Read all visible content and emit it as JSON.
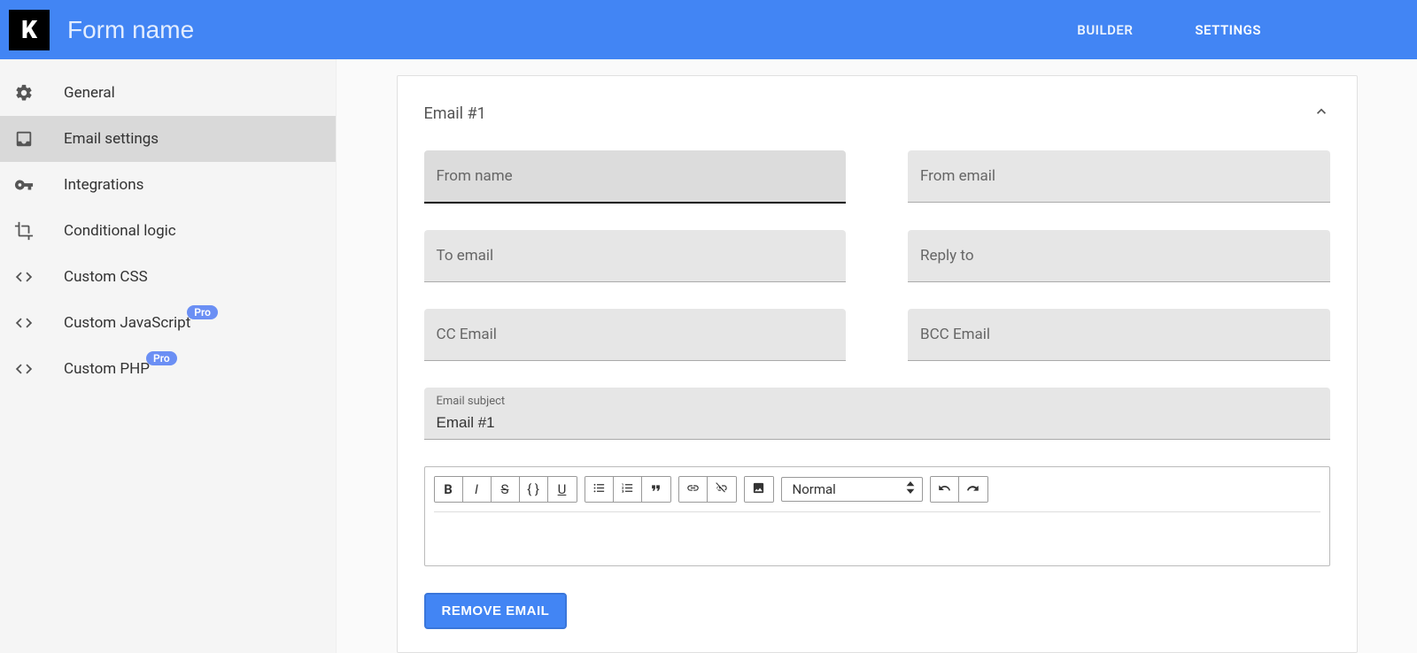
{
  "topbar": {
    "form_name_placeholder": "Form name",
    "tabs": {
      "builder": "BUILDER",
      "settings": "SETTINGS"
    }
  },
  "sidebar": {
    "items": {
      "general": "General",
      "email_settings": "Email settings",
      "integrations": "Integrations",
      "conditional_logic": "Conditional logic",
      "custom_css": "Custom CSS",
      "custom_js": "Custom JavaScript",
      "custom_php": "Custom PHP"
    },
    "pro_label": "Pro"
  },
  "panel": {
    "title": "Email #1",
    "fields": {
      "from_name": {
        "label": "From name",
        "value": ""
      },
      "from_email": {
        "label": "From email",
        "value": ""
      },
      "to_email": {
        "label": "To email",
        "value": ""
      },
      "reply_to": {
        "label": "Reply to",
        "value": ""
      },
      "cc_email": {
        "label": "CC Email",
        "value": ""
      },
      "bcc_email": {
        "label": "BCC Email",
        "value": ""
      },
      "subject": {
        "label": "Email subject",
        "value": "Email #1"
      }
    },
    "editor": {
      "format_label": "Normal"
    },
    "remove_button": "REMOVE EMAIL"
  }
}
